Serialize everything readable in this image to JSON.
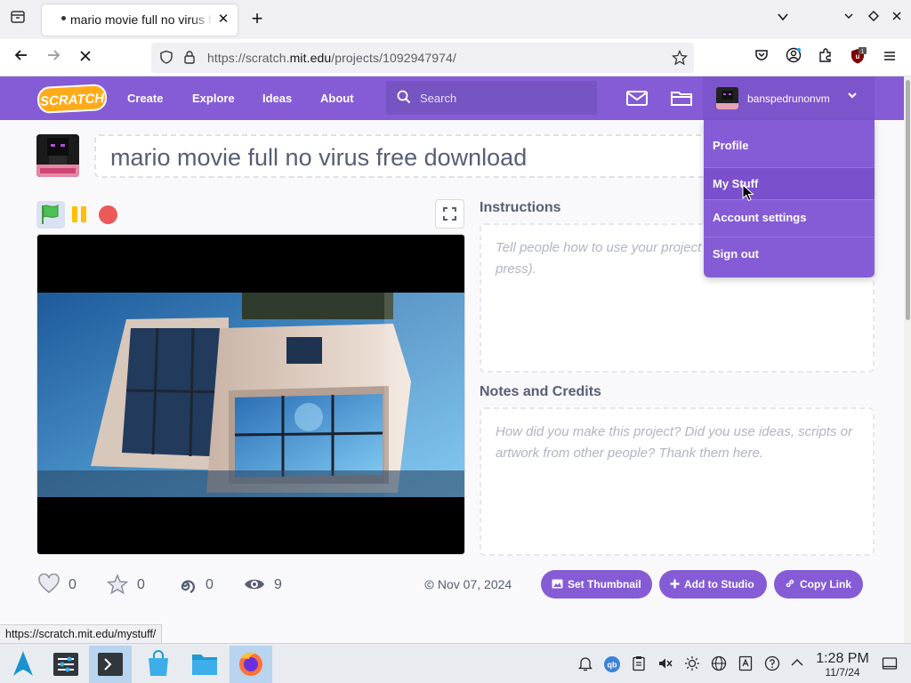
{
  "browser": {
    "tab_title": "mario movie full no virus free download",
    "tab_close": "✕",
    "new_tab": "+",
    "url_prefix": "https://scratch.",
    "url_domain": "mit.edu",
    "url_path": "/projects/1092947974/",
    "status_url": "https://scratch.mit.edu/mystuff/",
    "extension_badge": "1"
  },
  "scratch_nav": {
    "logo": "SCRATCH",
    "links": [
      "Create",
      "Explore",
      "Ideas",
      "About"
    ],
    "search_placeholder": "Search",
    "username": "banspedrunonvm"
  },
  "account_menu": {
    "items": [
      "Profile",
      "My Stuff",
      "Account settings",
      "Sign out"
    ],
    "hovered": "My Stuff"
  },
  "project": {
    "title": "mario movie full no virus free download",
    "instructions_heading": "Instructions",
    "instructions_placeholder": "Tell people how to use your project (such as which keys to press).",
    "notes_heading": "Notes and Credits",
    "notes_placeholder": "How did you make this project? Did you use ideas, scripts or artwork from other people? Thank them here.",
    "loves": "0",
    "favorites": "0",
    "remixes": "0",
    "views": "9",
    "date": "Nov 07, 2024",
    "set_thumbnail": "Set Thumbnail",
    "add_to_studio": "Add to Studio",
    "copy_link": "Copy Link"
  },
  "taskbar": {
    "time": "1:28 PM",
    "date": "11/7/24"
  },
  "colors": {
    "scratch_purple": "#855cd6",
    "scratch_orange": "#ffab19",
    "stop_red": "#ec5959"
  }
}
